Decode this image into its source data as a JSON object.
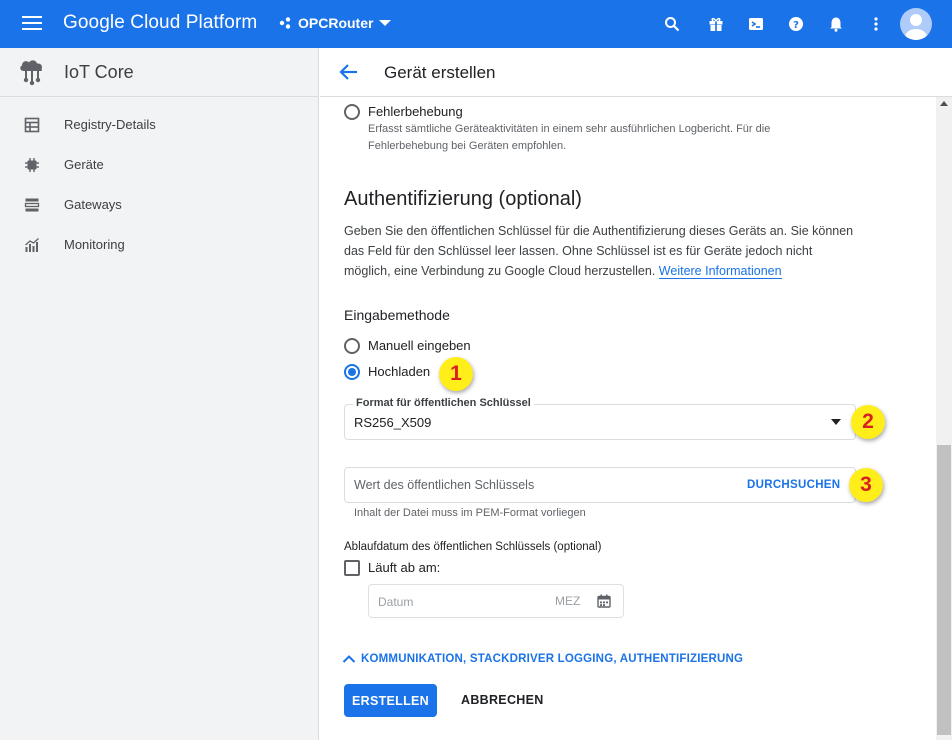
{
  "topbar": {
    "brand": "Google Cloud Platform",
    "project": "OPCRouter",
    "icons": [
      "menu-icon",
      "search-icon",
      "gift-icon",
      "terminal-icon",
      "help-icon",
      "bell-icon",
      "more-vert-icon",
      "account-avatar"
    ],
    "color": "#1a73e8"
  },
  "sidebar": {
    "title": "IoT Core",
    "items": [
      {
        "label": "Registry-Details",
        "icon": "table-icon"
      },
      {
        "label": "Geräte",
        "icon": "chip-icon"
      },
      {
        "label": "Gateways",
        "icon": "gateway-icon"
      },
      {
        "label": "Monitoring",
        "icon": "chart-icon"
      }
    ]
  },
  "main": {
    "title": "Gerät erstellen",
    "log_option": {
      "label": "Fehlerbehebung",
      "description": "Erfasst sämtliche Geräteaktivitäten in einem sehr ausführlichen Logbericht. Für die Fehlerbehebung bei Geräten empfohlen."
    },
    "auth": {
      "heading": "Authentifizierung (optional)",
      "description": "Geben Sie den öffentlichen Schlüssel für die Authentifizierung dieses Geräts an. Sie können das Feld für den Schlüssel leer lassen. Ohne Schlüssel ist es für Geräte jedoch nicht möglich, eine Verbindung zu Google Cloud herzustellen.",
      "link": "Weitere Informationen",
      "input_method_label": "Eingabemethode",
      "options": [
        "Manuell eingeben",
        "Hochladen"
      ],
      "selected": "Hochladen",
      "format_label": "Format für öffentlichen Schlüssel",
      "format_value": "RS256_X509",
      "key_placeholder": "Wert des öffentlichen Schlüssels",
      "browse_label": "DURCHSUCHEN",
      "key_hint": "Inhalt der Datei muss im PEM-Format vorliegen",
      "expiry_label": "Ablaufdatum des öffentlichen Schlüssels (optional)",
      "expiry_checkbox": "Läuft ab am:",
      "date_placeholder": "Datum",
      "timezone": "MEZ"
    },
    "collapse_label": "KOMMUNIKATION, STACKDRIVER LOGGING, AUTHENTIFIZIERUNG",
    "create_button": "ERSTELLEN",
    "cancel_button": "ABBRECHEN"
  },
  "callouts": [
    "1",
    "2",
    "3"
  ]
}
